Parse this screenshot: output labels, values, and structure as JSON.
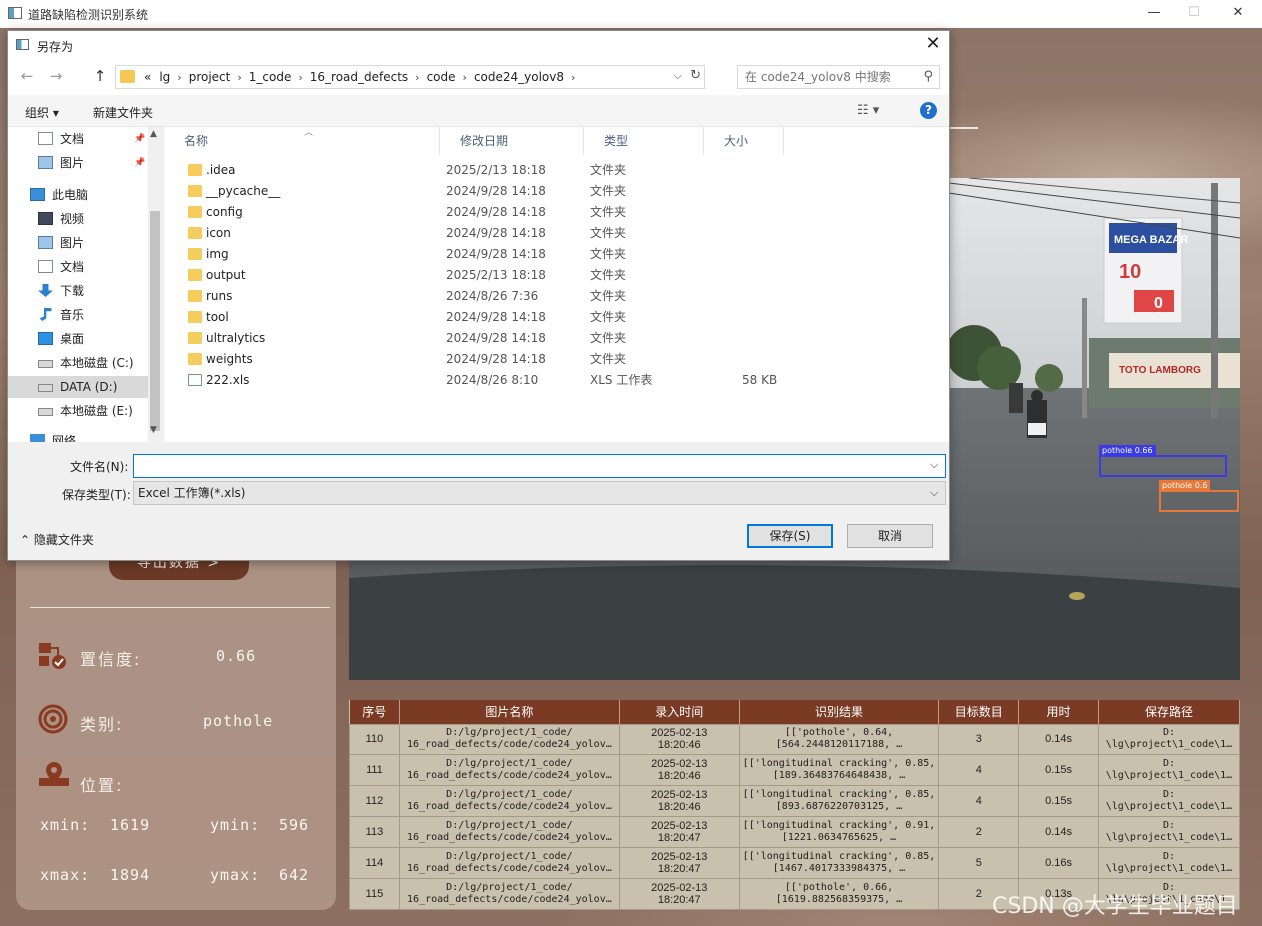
{
  "window": {
    "title": "道路缺陷检测识别系统",
    "minimize": "—",
    "maximize": "☐",
    "close": "✕"
  },
  "left_panel": {
    "export_label": "导出数据 >",
    "confidence_label": "置信度:",
    "confidence_value": "0.66",
    "class_label": "类别:",
    "class_value": "pothole",
    "position_label": "位置:",
    "xmin_label": "xmin:",
    "xmin_value": "1619",
    "ymin_label": "ymin:",
    "ymin_value": "596",
    "xmax_label": "xmax:",
    "xmax_value": "1894",
    "ymax_label": "ymax:",
    "ymax_value": "642"
  },
  "image": {
    "billboard_1": "MEGA BAZAR",
    "billboard_2": "10",
    "billboard_3": "0",
    "shop_sign": "TOTO LAMBORG",
    "detections": [
      {
        "label": "pothole 0.66",
        "color": "#3a3ae8"
      },
      {
        "label": "pothole 0.6",
        "color": "#e8783a"
      }
    ]
  },
  "table": {
    "headers": [
      "序号",
      "图片名称",
      "录入时间",
      "识别结果",
      "目标数目",
      "用时",
      "保存路径"
    ],
    "rows": [
      [
        "110",
        "D:/lg/project/1_code/\n16_road_defects/code/code24_yolov…",
        "2025-02-13\n18:20:46",
        "[['pothole', 0.64,\n[564.2448120117188, …",
        "3",
        "0.14s",
        "D:\n\\lg\\project\\1_code\\1…"
      ],
      [
        "111",
        "D:/lg/project/1_code/\n16_road_defects/code/code24_yolov…",
        "2025-02-13\n18:20:46",
        "[['longitudinal cracking', 0.85,\n[189.36483764648438, …",
        "4",
        "0.15s",
        "D:\n\\lg\\project\\1_code\\1…"
      ],
      [
        "112",
        "D:/lg/project/1_code/\n16_road_defects/code/code24_yolov…",
        "2025-02-13\n18:20:46",
        "[['longitudinal cracking', 0.85,\n[893.6876220703125, …",
        "4",
        "0.15s",
        "D:\n\\lg\\project\\1_code\\1…"
      ],
      [
        "113",
        "D:/lg/project/1_code/\n16_road_defects/code/code24_yolov…",
        "2025-02-13\n18:20:47",
        "[['longitudinal cracking', 0.91,\n[1221.0634765625, …",
        "2",
        "0.14s",
        "D:\n\\lg\\project\\1_code\\1…"
      ],
      [
        "114",
        "D:/lg/project/1_code/\n16_road_defects/code/code24_yolov…",
        "2025-02-13\n18:20:47",
        "[['longitudinal cracking', 0.85,\n[1467.4017333984375, …",
        "5",
        "0.16s",
        "D:\n\\lg\\project\\1_code\\1…"
      ],
      [
        "115",
        "D:/lg/project/1_code/\n16_road_defects/code/code24_yolov…",
        "2025-02-13\n18:20:47",
        "[['pothole', 0.66,\n[1619.882568359375, …",
        "2",
        "0.13s",
        "D:\n\\lg\\project\\1_code\\1…"
      ]
    ]
  },
  "watermark": "CSDN @大学生毕业题目",
  "dialog": {
    "title": "另存为",
    "close": "✕",
    "back": "←",
    "forward": "→",
    "up": "↑",
    "breadcrumbs": [
      "«",
      "lg",
      "project",
      "1_code",
      "16_road_defects",
      "code",
      "code24_yolov8"
    ],
    "search_placeholder": "在 code24_yolov8 中搜索",
    "organize": "组织 ▾",
    "new_folder": "新建文件夹",
    "help": "?",
    "nav_items": [
      {
        "label": "文档",
        "icon": "document-icon",
        "pinned": true
      },
      {
        "label": "图片",
        "icon": "picture-icon",
        "pinned": true
      },
      {
        "label": "此电脑",
        "icon": "computer-icon",
        "pinned": false
      },
      {
        "label": "视频",
        "icon": "video-icon",
        "pinned": false
      },
      {
        "label": "图片",
        "icon": "picture-icon",
        "pinned": false
      },
      {
        "label": "文档",
        "icon": "document-icon",
        "pinned": false
      },
      {
        "label": "下载",
        "icon": "download-icon",
        "pinned": false
      },
      {
        "label": "音乐",
        "icon": "music-icon",
        "pinned": false
      },
      {
        "label": "桌面",
        "icon": "desktop-icon",
        "pinned": false
      },
      {
        "label": "本地磁盘 (C:)",
        "icon": "drive-icon",
        "pinned": false
      },
      {
        "label": "DATA (D:)",
        "icon": "drive-icon",
        "pinned": false,
        "selected": true
      },
      {
        "label": "本地磁盘 (E:)",
        "icon": "drive-icon",
        "pinned": false
      },
      {
        "label": "网络",
        "icon": "network-icon",
        "pinned": false
      }
    ],
    "columns": [
      "名称",
      "修改日期",
      "类型",
      "大小"
    ],
    "files": [
      {
        "name": ".idea",
        "date": "2025/2/13 18:18",
        "type": "文件夹",
        "size": "",
        "kind": "folder"
      },
      {
        "name": "__pycache__",
        "date": "2024/9/28 14:18",
        "type": "文件夹",
        "size": "",
        "kind": "folder"
      },
      {
        "name": "config",
        "date": "2024/9/28 14:18",
        "type": "文件夹",
        "size": "",
        "kind": "folder"
      },
      {
        "name": "icon",
        "date": "2024/9/28 14:18",
        "type": "文件夹",
        "size": "",
        "kind": "folder"
      },
      {
        "name": "img",
        "date": "2024/9/28 14:18",
        "type": "文件夹",
        "size": "",
        "kind": "folder"
      },
      {
        "name": "output",
        "date": "2025/2/13 18:18",
        "type": "文件夹",
        "size": "",
        "kind": "folder"
      },
      {
        "name": "runs",
        "date": "2024/8/26 7:36",
        "type": "文件夹",
        "size": "",
        "kind": "folder"
      },
      {
        "name": "tool",
        "date": "2024/9/28 14:18",
        "type": "文件夹",
        "size": "",
        "kind": "folder"
      },
      {
        "name": "ultralytics",
        "date": "2024/9/28 14:18",
        "type": "文件夹",
        "size": "",
        "kind": "folder"
      },
      {
        "name": "weights",
        "date": "2024/9/28 14:18",
        "type": "文件夹",
        "size": "",
        "kind": "folder"
      },
      {
        "name": "222.xls",
        "date": "2024/8/26 8:10",
        "type": "XLS 工作表",
        "size": "58 KB",
        "kind": "xls"
      }
    ],
    "filename_label": "文件名(N):",
    "filename_value": "",
    "filetype_label": "保存类型(T):",
    "filetype_value": "Excel 工作簿(*.xls)",
    "hide_folders": "隐藏文件夹",
    "save": "保存(S)",
    "cancel": "取消"
  }
}
